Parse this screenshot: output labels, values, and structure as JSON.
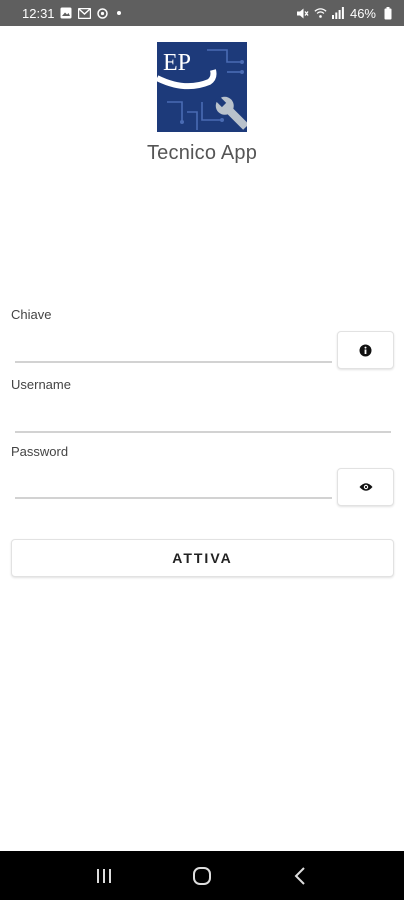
{
  "status_bar": {
    "time": "12:31",
    "battery": "46%",
    "left_icons": [
      "image-icon",
      "mail-icon",
      "sync-icon"
    ],
    "right_icons": [
      "mute-icon",
      "wifi-icon",
      "signal-icon",
      "battery-icon"
    ]
  },
  "header": {
    "logo_text": "EP",
    "app_title": "Tecnico App"
  },
  "form": {
    "key_label": "Chiave",
    "key_value": "",
    "key_info_icon": "info-icon",
    "username_label": "Username",
    "username_value": "",
    "password_label": "Password",
    "password_value": "",
    "password_toggle_icon": "eye-icon",
    "activate_label": "ATTIVA"
  },
  "nav_bar": {
    "buttons": [
      "recents-icon",
      "home-icon",
      "back-icon"
    ]
  },
  "colors": {
    "status_bar_bg": "#5f5f5f",
    "logo_bg": "#1d3a7a",
    "nav_bar_bg": "#000000"
  }
}
